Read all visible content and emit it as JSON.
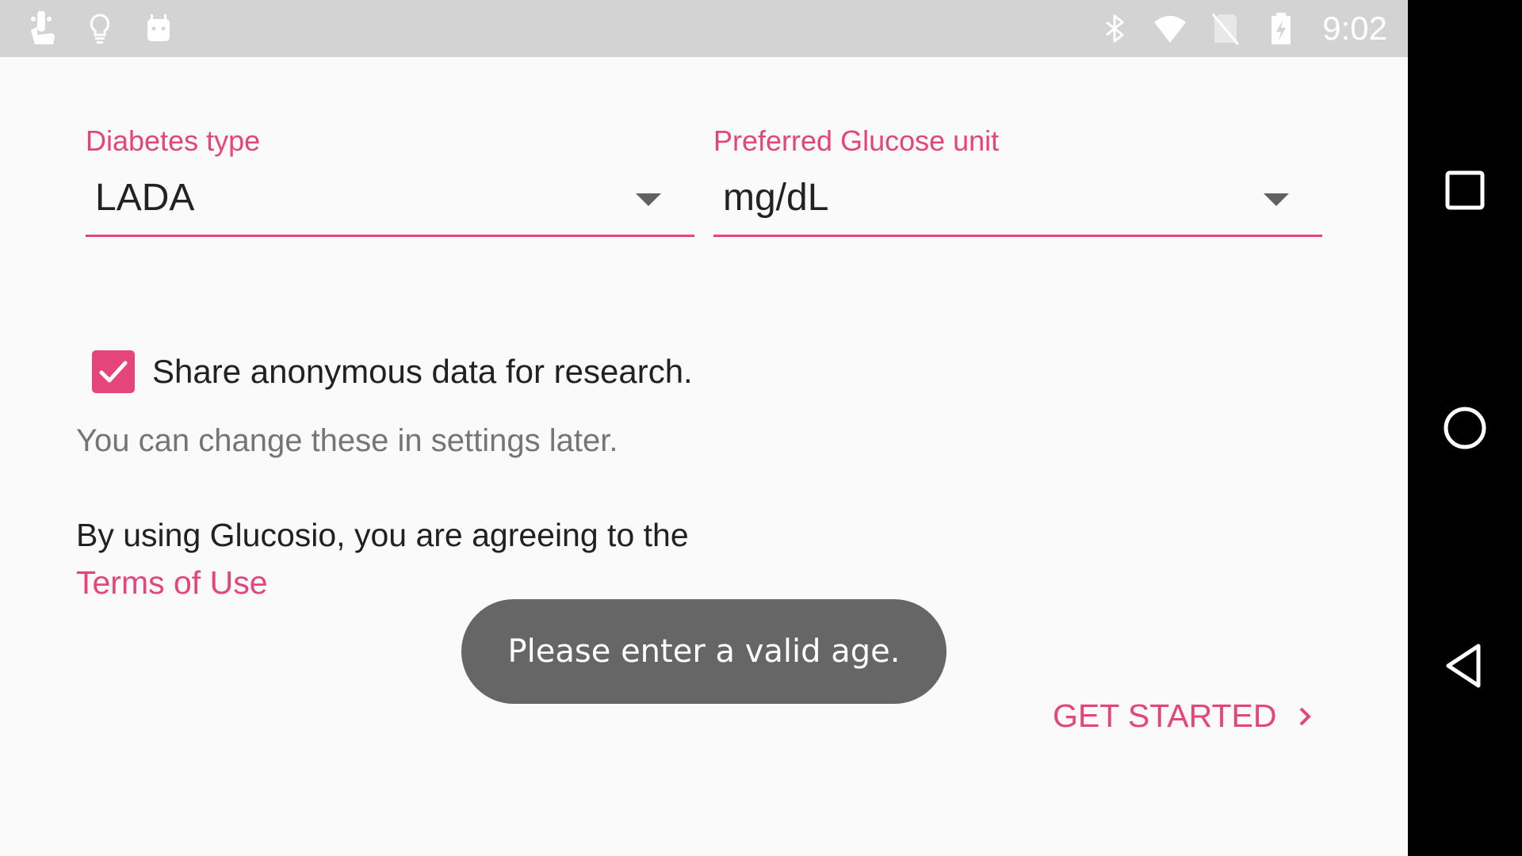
{
  "status_bar": {
    "time": "9:02",
    "left_icons": [
      "touch-icon",
      "lightbulb-icon",
      "android-icon"
    ],
    "right_icons": [
      "bluetooth-icon",
      "wifi-icon",
      "no-sim-icon",
      "battery-charging-icon"
    ]
  },
  "form": {
    "diabetes_type": {
      "label": "Diabetes type",
      "value": "LADA"
    },
    "glucose_unit": {
      "label": "Preferred Glucose unit",
      "value": "mg/dL"
    },
    "share_data": {
      "label": "Share anonymous data for research.",
      "checked": true
    },
    "hint": "You can change these in settings later.",
    "agreement": "By using Glucosio, you are agreeing to the",
    "terms_link": "Terms of Use",
    "get_started": "GET STARTED"
  },
  "toast": {
    "message": "Please enter a valid age."
  },
  "nav_bar": {
    "buttons": [
      "recents-icon",
      "home-icon",
      "back-icon"
    ]
  },
  "colors": {
    "accent": "#e4457a",
    "status_bar": "#d3d3d3",
    "nav_bar": "#000000",
    "toast_bg": "#666666"
  }
}
